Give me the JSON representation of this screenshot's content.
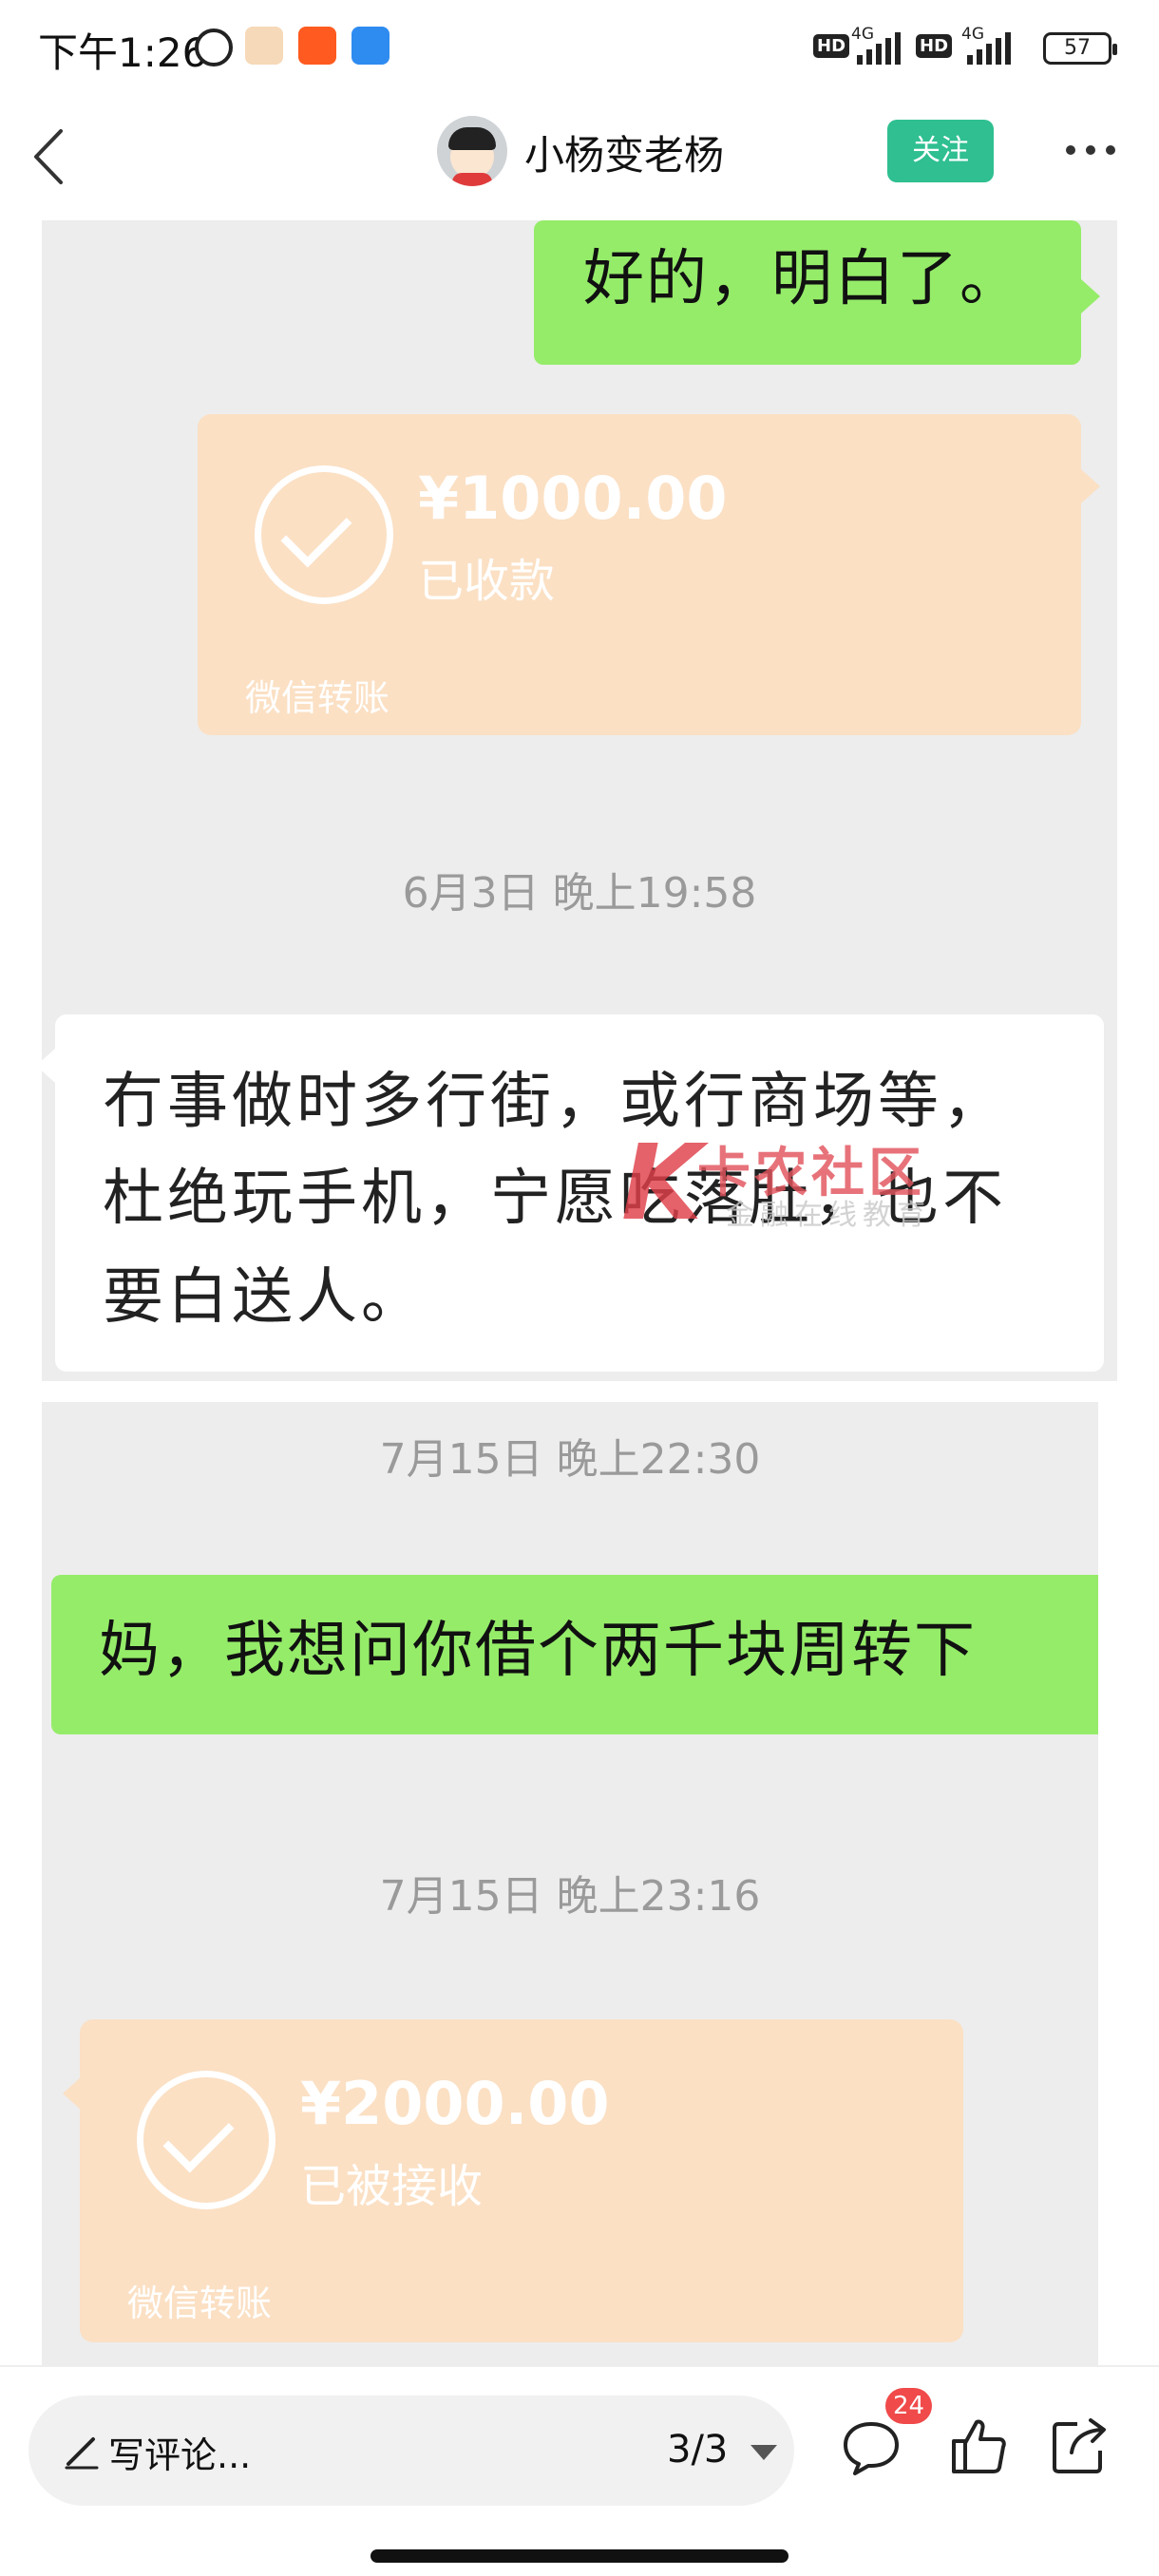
{
  "status_bar": {
    "time": "下午1:26",
    "network_1": "4G",
    "network_2": "4G",
    "hd_1": "HD",
    "hd_2": "HD",
    "battery": "57"
  },
  "nav": {
    "title": "小杨变老杨",
    "follow_label": "关注"
  },
  "chat": {
    "msg_1": "好的，明白了。",
    "transfer_1": {
      "amount": "¥1000.00",
      "status": "已收款",
      "label": "微信转账"
    },
    "time_1": "6月3日 晚上19:58",
    "msg_2_lines": [
      "冇事做时多行街，或行商场等，",
      "杜绝玩手机，宁愿吃落肚，也不",
      "要白送人。"
    ],
    "watermark": {
      "logo": "K",
      "name": "卡农社区",
      "sub": "金融在线教育"
    },
    "time_2": "7月15日 晚上22:30",
    "msg_3": "妈，我想问你借个两千块周转下",
    "time_3": "7月15日 晚上23:16",
    "transfer_2": {
      "amount": "¥2000.00",
      "status": "已被接收",
      "label": "微信转账"
    }
  },
  "bottom": {
    "comment_placeholder": "写评论...",
    "page_counter": "3/3",
    "comment_count": "24"
  },
  "colors": {
    "accent": "#2fbf91",
    "bubble_green": "#95ec69",
    "transfer_peach": "#fbe0c4",
    "badge_red": "#f04a4a"
  },
  "icons": [
    "back-arrow-icon",
    "more-icon",
    "pen-icon",
    "caret-down-icon",
    "comment-icon",
    "like-icon",
    "share-icon",
    "check-icon"
  ]
}
